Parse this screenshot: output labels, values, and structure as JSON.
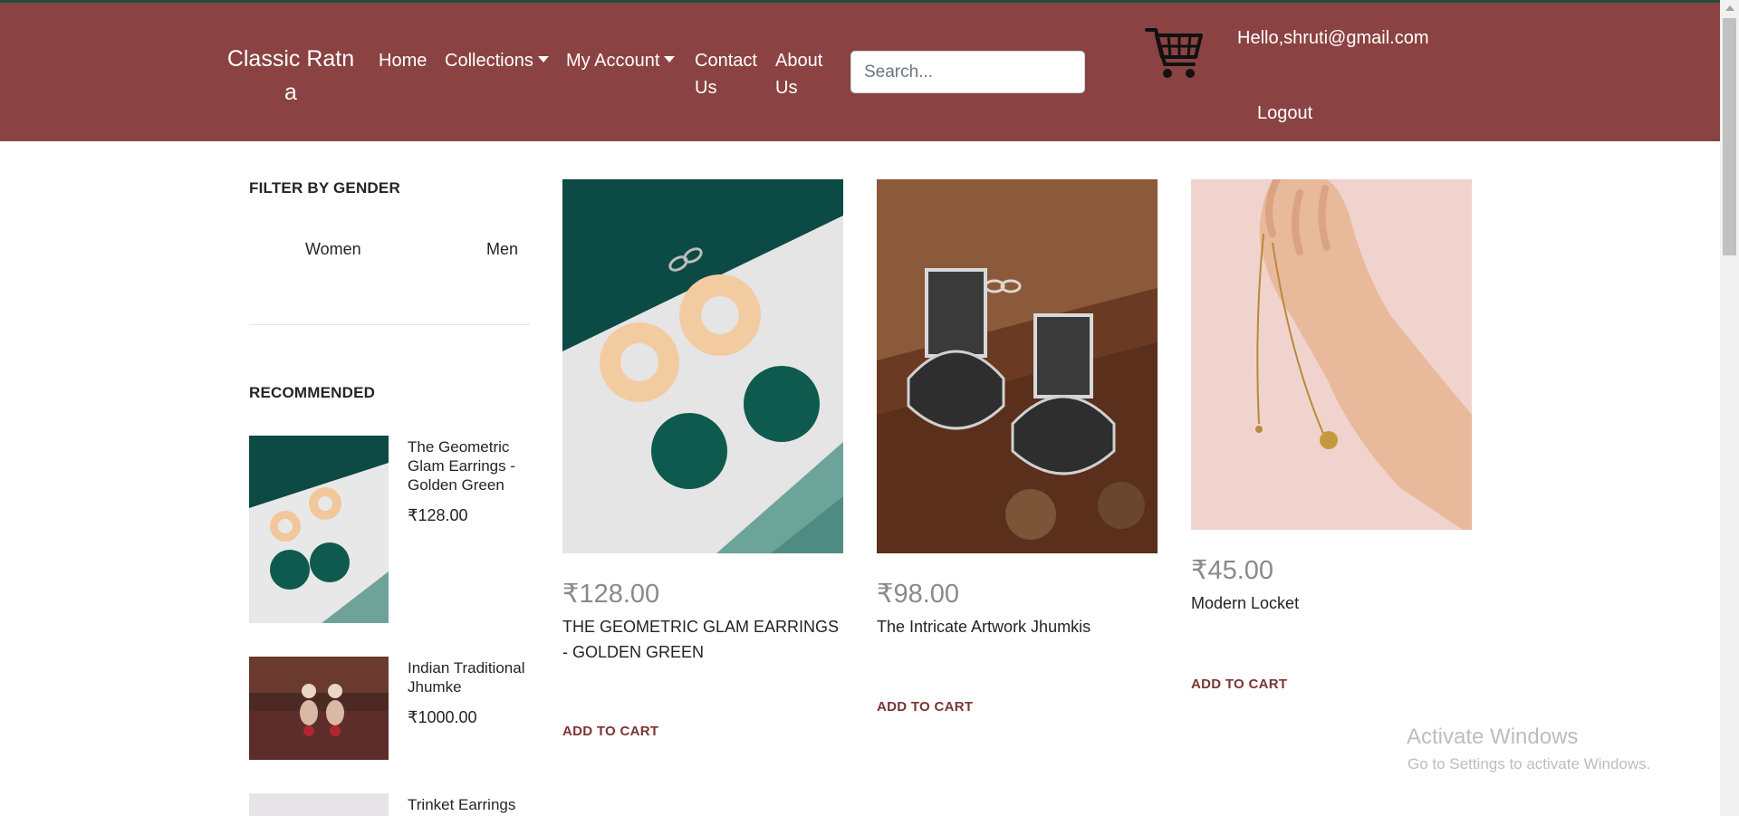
{
  "header": {
    "brand": "Classic Ratna",
    "nav": {
      "home": "Home",
      "collections": "Collections",
      "my_account": "My Account",
      "contact": "Contact Us",
      "about": "About Us"
    },
    "search_placeholder": "Search...",
    "cart_icon": "shopping-cart-icon",
    "greeting": "Hello,shruti@gmail.com",
    "logout": "Logout"
  },
  "sidebar": {
    "filter_title": "FILTER BY GENDER",
    "genders": [
      "Women",
      "Men"
    ],
    "recommended_title": "RECOMMENDED",
    "recommended": [
      {
        "name": "The Geometric Glam Earrings - Golden Green",
        "price": "₹128.00"
      },
      {
        "name": "Indian Traditional Jhumke",
        "price": "₹1000.00"
      },
      {
        "name": "Trinket Earrings",
        "price": ""
      }
    ]
  },
  "products": [
    {
      "price": "₹128.00",
      "name": "THE GEOMETRIC GLAM EARRINGS - GOLDEN GREEN",
      "cta": "ADD TO CART"
    },
    {
      "price": "₹98.00",
      "name": "The Intricate Artwork Jhumkis",
      "cta": "ADD TO CART"
    },
    {
      "price": "₹45.00",
      "name": "Modern Locket",
      "cta": "ADD TO CART"
    }
  ],
  "watermark": {
    "title": "Activate Windows",
    "subtitle": "Go to Settings to activate Windows."
  },
  "colors": {
    "navbar_bg": "#8b4242",
    "accent_text": "#7a3434",
    "price_gray": "#8a8a8a"
  }
}
